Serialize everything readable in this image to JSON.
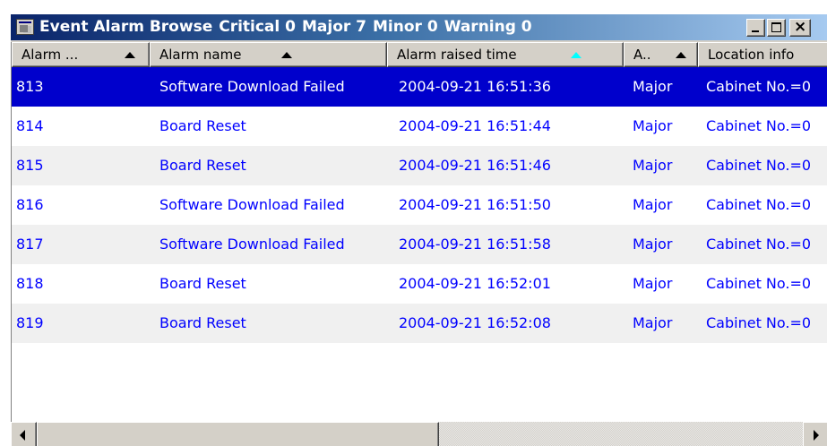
{
  "window": {
    "title": "Event Alarm Browse",
    "counts": [
      {
        "label": "Critical 0"
      },
      {
        "label": "Major 7"
      },
      {
        "label": "Minor 0"
      },
      {
        "label": "Warning 0"
      }
    ],
    "icons": [
      "app-window-icon",
      "minimize-icon",
      "maximize-icon",
      "close-icon"
    ],
    "colors": {
      "titlebar_start": "#0a246a",
      "titlebar_end": "#a6caf0",
      "selection": "#0000cc",
      "row_text": "#0000ff"
    }
  },
  "columns": [
    {
      "label": "Alarm ...",
      "sort": "asc"
    },
    {
      "label": "Alarm name",
      "sort": "asc"
    },
    {
      "label": "Alarm raised time",
      "sort": "asc-active"
    },
    {
      "label": "A..",
      "sort": "asc"
    },
    {
      "label": "Location info",
      "sort": "none"
    }
  ],
  "rows": [
    {
      "id": "813",
      "name": "Software Download Failed",
      "time": "2004-09-21 16:51:36",
      "severity": "Major",
      "location": "Cabinet No.=0",
      "selected": true
    },
    {
      "id": "814",
      "name": "Board Reset",
      "time": "2004-09-21 16:51:44",
      "severity": "Major",
      "location": "Cabinet No.=0",
      "selected": false
    },
    {
      "id": "815",
      "name": "Board Reset",
      "time": "2004-09-21 16:51:46",
      "severity": "Major",
      "location": "Cabinet No.=0",
      "selected": false
    },
    {
      "id": "816",
      "name": "Software Download Failed",
      "time": "2004-09-21 16:51:50",
      "severity": "Major",
      "location": "Cabinet No.=0",
      "selected": false
    },
    {
      "id": "817",
      "name": "Software Download Failed",
      "time": "2004-09-21 16:51:58",
      "severity": "Major",
      "location": "Cabinet No.=0",
      "selected": false
    },
    {
      "id": "818",
      "name": "Board Reset",
      "time": "2004-09-21 16:52:01",
      "severity": "Major",
      "location": "Cabinet No.=0",
      "selected": false
    },
    {
      "id": "819",
      "name": "Board Reset",
      "time": "2004-09-21 16:52:08",
      "severity": "Major",
      "location": "Cabinet No.=0",
      "selected": false
    }
  ]
}
